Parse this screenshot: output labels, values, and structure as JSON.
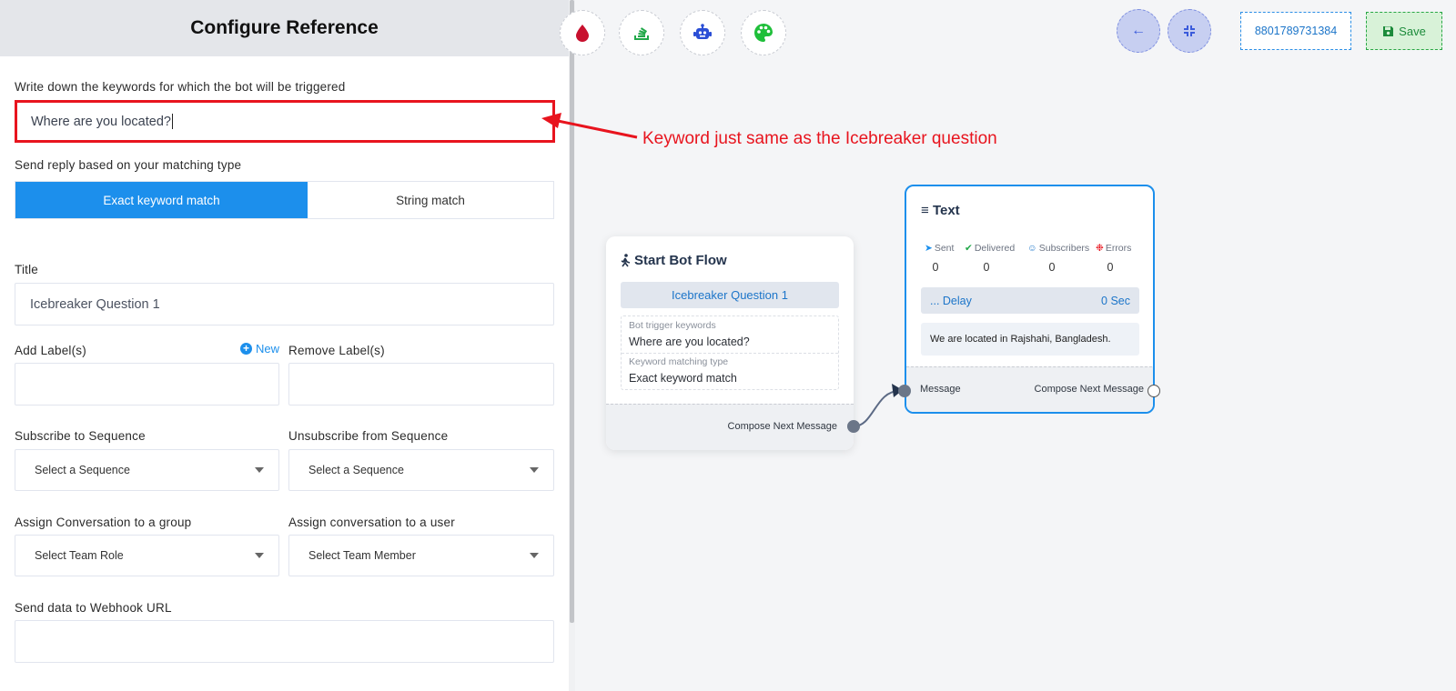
{
  "panel": {
    "title": "Configure Reference",
    "keyword_label": "Write down the keywords for which the bot will be triggered",
    "keyword_value": "Where are you located?",
    "matching_label": "Send reply based on your matching type",
    "match_options": [
      "Exact keyword match",
      "String match"
    ],
    "title_label": "Title",
    "title_value": "Icebreaker Question 1",
    "add_label": "Add Label(s)",
    "new_link": "New",
    "remove_label": "Remove Label(s)",
    "subscribe_label": "Subscribe to Sequence",
    "unsubscribe_label": "Unsubscribe from Sequence",
    "sequence_placeholder": "Select a Sequence",
    "group_label": "Assign Conversation to a group",
    "group_placeholder": "Select Team Role",
    "user_label": "Assign conversation to a user",
    "user_placeholder": "Select Team Member",
    "webhook_label": "Send data to Webhook URL"
  },
  "toolbar": {
    "tools": [
      "blood-drop-icon",
      "stack-icon",
      "robot-icon",
      "palette-icon"
    ],
    "nav": [
      "arrow-left-icon",
      "compress-icon"
    ],
    "phone": "8801789731384",
    "save_label": "Save"
  },
  "annotation": "Keyword just same as the Icebreaker question",
  "start_node": {
    "title": "Start Bot Flow",
    "reference": "Icebreaker Question 1",
    "keywords_label": "Bot trigger keywords",
    "keywords_value": "Where are you located?",
    "matching_label": "Keyword matching type",
    "matching_value": "Exact keyword match",
    "output_label": "Compose Next Message"
  },
  "text_node": {
    "title": "Text",
    "stats": [
      {
        "label": "Sent",
        "value": "0",
        "color": "#1c8fec"
      },
      {
        "label": "Delivered",
        "value": "0",
        "color": "#22a84a"
      },
      {
        "label": "Subscribers",
        "value": "0",
        "color": "#1c75c9"
      },
      {
        "label": "Errors",
        "value": "0",
        "color": "#e8141e"
      }
    ],
    "delay_label": "... Delay",
    "delay_value": "0 Sec",
    "message": "We are located in Rajshahi, Bangladesh.",
    "input_label": "Message",
    "output_label": "Compose Next Message"
  },
  "colors": {
    "accent": "#1c8fec",
    "annotation": "#e8141e",
    "save": "#1c8b3b"
  }
}
